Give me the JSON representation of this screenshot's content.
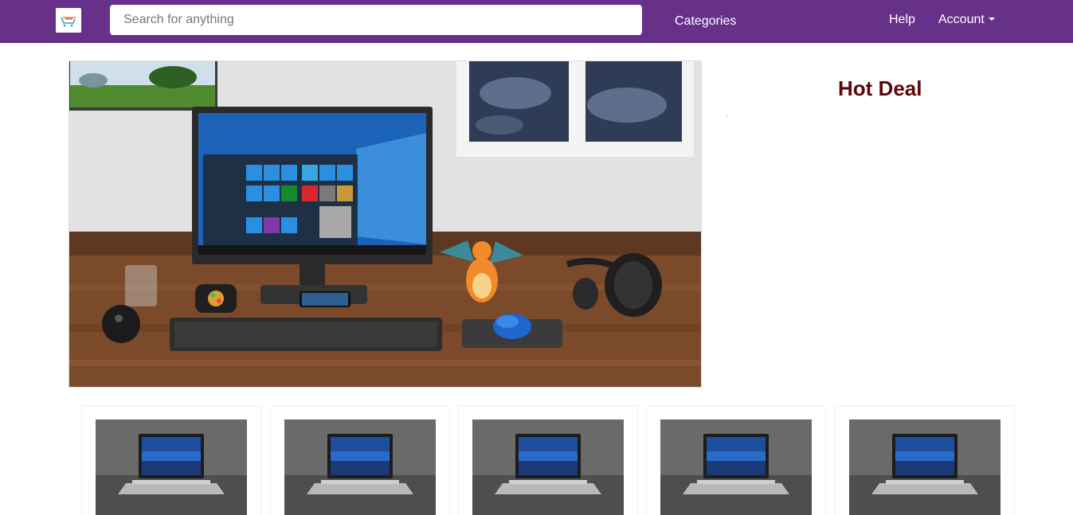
{
  "navbar": {
    "logo": "logo",
    "search_placeholder": "Search for anything",
    "categories": "Categories",
    "help": "Help",
    "account": "Account"
  },
  "sidebar": {
    "hot_deal_title": "Hot Deal"
  },
  "products": [
    {
      "image": "laptop"
    },
    {
      "image": "laptop"
    },
    {
      "image": "laptop"
    },
    {
      "image": "laptop"
    },
    {
      "image": "laptop"
    }
  ],
  "colors": {
    "navbar": "#67318a",
    "hot_deal": "#5c0808"
  }
}
